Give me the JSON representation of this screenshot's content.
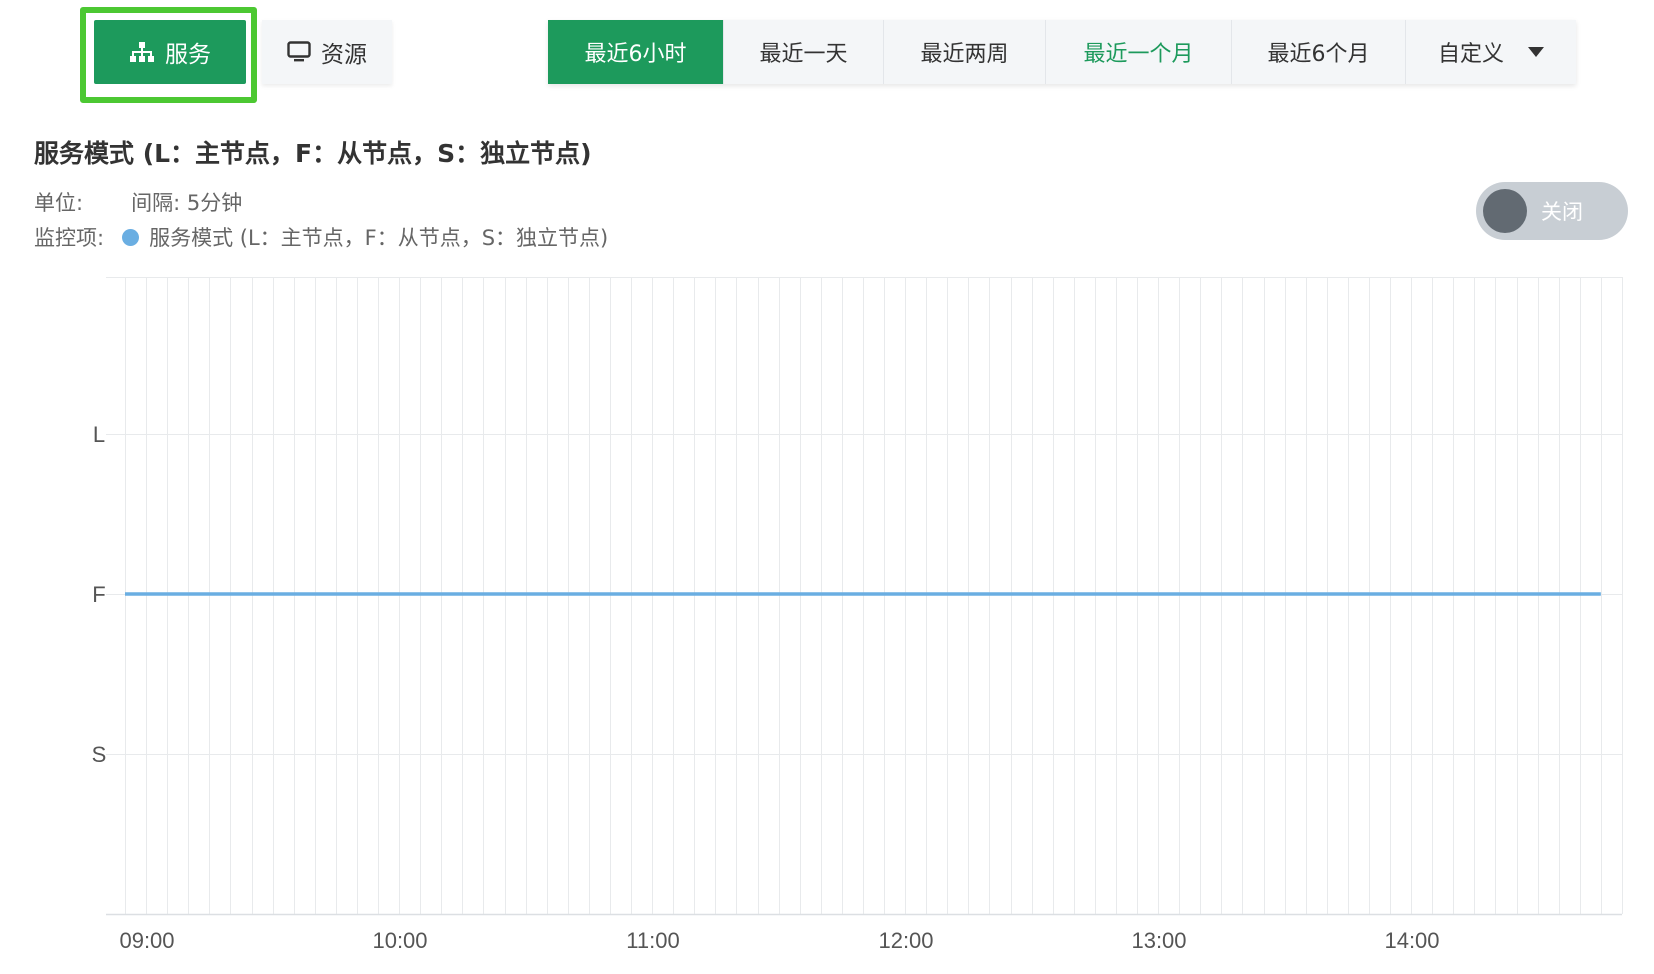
{
  "tabs": {
    "service_label": "服务",
    "resource_label": "资源",
    "active": "service",
    "highlight_color": "#4cc832"
  },
  "range_buttons": [
    {
      "label": "最近6小时",
      "state": "active"
    },
    {
      "label": "最近一天",
      "state": "normal"
    },
    {
      "label": "最近两周",
      "state": "normal"
    },
    {
      "label": "最近一个月",
      "state": "green-text"
    },
    {
      "label": "最近6个月",
      "state": "normal"
    },
    {
      "label": "自定义",
      "state": "dropdown"
    }
  ],
  "chart_title": "服务模式 (L：主节点，F：从节点，S：独立节点)",
  "meta": {
    "unit_label": "单位:",
    "interval_label": "间隔: 5分钟",
    "monitor_label": "监控项:",
    "legend_text": "服务模式 (L：主节点，F：从节点，S：独立节点)"
  },
  "toggle": {
    "label": "关闭",
    "state": "off"
  },
  "colors": {
    "accent": "#1d9a5c",
    "series": "#6aaee2",
    "grid": "#e8eaec"
  },
  "chart_data": {
    "type": "line",
    "x_ticks": [
      "09:00",
      "10:00",
      "11:00",
      "12:00",
      "13:00",
      "14:00"
    ],
    "y_categories": [
      "S",
      "F",
      "L"
    ],
    "x_range": [
      "08:55",
      "14:50"
    ],
    "interval_minutes": 5,
    "series": [
      {
        "name": "服务模式 (L：主节点，F：从节点，S：独立节点)",
        "color": "#6aaee2",
        "start": "08:55",
        "end": "14:50",
        "value": "F"
      }
    ],
    "grid": true
  }
}
